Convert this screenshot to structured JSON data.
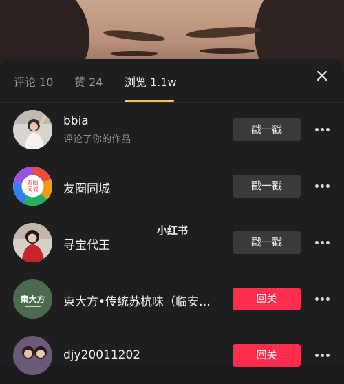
{
  "tabs": [
    {
      "label": "评论 10"
    },
    {
      "label": "赞 24"
    },
    {
      "label": "浏览 1.1w"
    }
  ],
  "watermark": "小红书",
  "users": [
    {
      "name": "bbia",
      "subtitle": "评论了你的作品",
      "button": "戳一戳",
      "button_style": "gray"
    },
    {
      "name": "友圈同城",
      "subtitle": "",
      "button": "戳一戳",
      "button_style": "gray"
    },
    {
      "name": "寻宝代王",
      "subtitle": "",
      "button": "戳一戳",
      "button_style": "gray"
    },
    {
      "name": "東大方•传统苏杭味（临安…",
      "subtitle": "",
      "button": "回关",
      "button_style": "red"
    },
    {
      "name": "djy20011202",
      "subtitle": "",
      "button": "回关",
      "button_style": "red"
    }
  ],
  "avatar_texts": {
    "youquan_top": "友圈",
    "youquan_bottom": "同城",
    "dongdafang": "東大方"
  },
  "colors": {
    "accent_yellow": "#f5c94c",
    "follow_red": "#ff2e4d",
    "poke_gray": "#3a3a3c",
    "panel_bg": "#1e1e20"
  }
}
